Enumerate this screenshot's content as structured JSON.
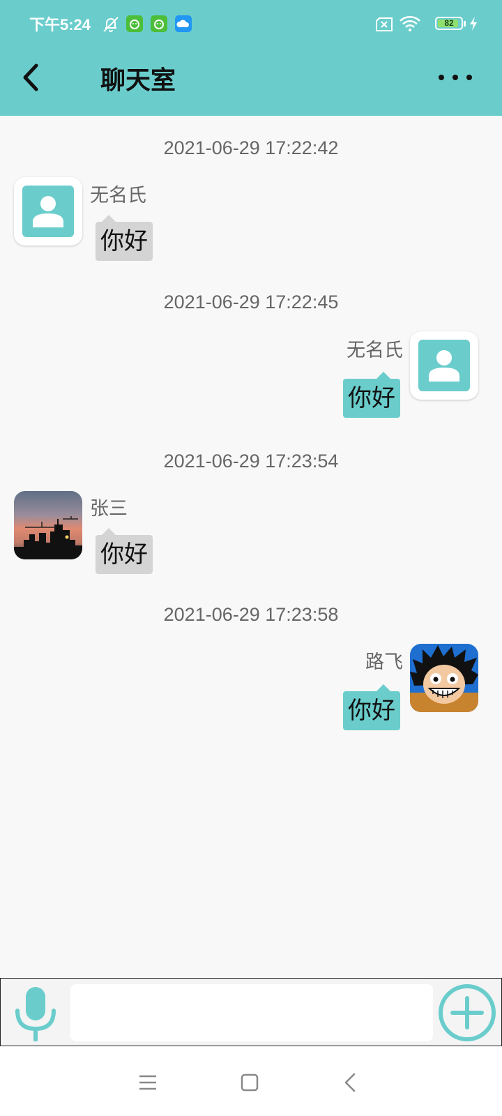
{
  "status_bar": {
    "time": "下午5:24",
    "battery_level": "82",
    "icons": [
      "notification-muted-icon",
      "app-badge-icon",
      "app-badge-icon",
      "cloud-app-icon",
      "sim-disabled-icon",
      "wifi-icon",
      "battery-icon",
      "charging-icon"
    ]
  },
  "header": {
    "title": "聊天室",
    "back_icon": "back-arrow-icon",
    "more_icon": "more-options-icon"
  },
  "messages": [
    {
      "timestamp": "2021-06-29 17:22:42",
      "sender": "无名氏",
      "text": "你好",
      "side": "left",
      "avatar": "default-contact-avatar"
    },
    {
      "timestamp": "2021-06-29 17:22:45",
      "sender": "无名氏",
      "text": "你好",
      "side": "right",
      "avatar": "default-contact-avatar"
    },
    {
      "timestamp": "2021-06-29 17:23:54",
      "sender": "张三",
      "text": "你好",
      "side": "left",
      "avatar": "city-sunset-photo"
    },
    {
      "timestamp": "2021-06-29 17:23:58",
      "sender": "路飞",
      "text": "你好",
      "side": "right",
      "avatar": "cartoon-character-photo"
    }
  ],
  "input_bar": {
    "message_value": "",
    "mic_icon": "microphone-icon",
    "add_icon": "add-circle-icon"
  },
  "nav_bar": {
    "icons": [
      "menu-icon",
      "home-icon",
      "back-icon"
    ]
  },
  "colors": {
    "accent": "#6acdcc",
    "background": "#f8f8f8",
    "bubble_received": "#d4d4d4",
    "bubble_sent": "#6acdcc",
    "timestamp_text": "#666666"
  }
}
